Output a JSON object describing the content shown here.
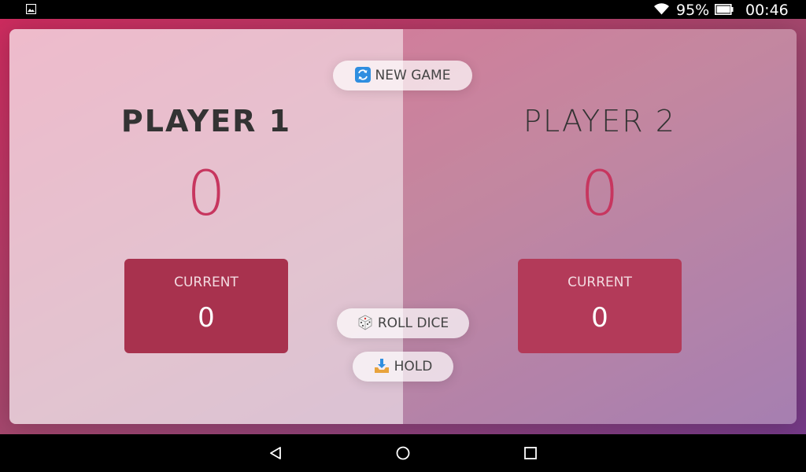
{
  "status_bar": {
    "battery_percent": "95%",
    "time": "00:46",
    "icons": [
      "gallery-icon",
      "wifi-icon",
      "battery-icon"
    ]
  },
  "game": {
    "new_game_label": "NEW GAME",
    "roll_dice_label": "ROLL DICE",
    "hold_label": "HOLD",
    "players": [
      {
        "name": "PLAYER 1",
        "score": "0",
        "current_label": "CURRENT",
        "current_score": "0",
        "active": true
      },
      {
        "name": "PLAYER 2",
        "score": "0",
        "current_label": "CURRENT",
        "current_score": "0",
        "active": false
      }
    ]
  },
  "nav_bar": {
    "icons": [
      "back-icon",
      "home-icon",
      "recents-icon"
    ]
  },
  "colors": {
    "score_accent": "#c7365f",
    "current_box": "#a8324e",
    "gradient_start": "#cc2b5e",
    "gradient_end": "#753a88"
  }
}
